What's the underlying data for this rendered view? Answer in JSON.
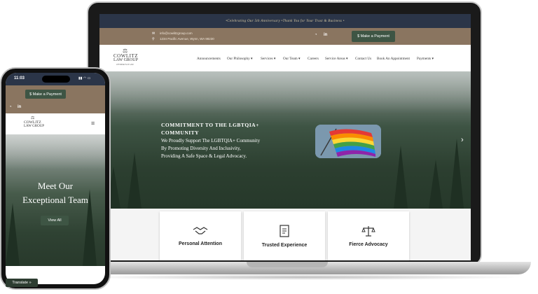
{
  "laptop_site": {
    "announcement": "•Celebrating Our 5th Anniversary •Thank You for Your Trust & Business •",
    "contact": {
      "email": "info@cowlitzgroup.com",
      "address": "1234 Pacific Avenue, Wynn, WA 98230"
    },
    "payment_button": "$ Make a Payment",
    "logo": {
      "line1": "COWLITZ",
      "line2": "LAW GROUP",
      "tagline": "ATTORNEYS AT LAW"
    },
    "nav": [
      {
        "label": "Announcements"
      },
      {
        "label": "Our Philosophy ▾"
      },
      {
        "label": "Services ▾"
      },
      {
        "label": "Our Team ▾"
      },
      {
        "label": "Careers"
      },
      {
        "label": "Service Areas ▾"
      },
      {
        "label": "Contact Us"
      },
      {
        "label": "Book An Appointment"
      },
      {
        "label": "Payments ▾"
      }
    ],
    "hero": {
      "heading_line1": "COMMITMENT TO THE LGBTQIA+",
      "heading_line2": "COMMUNITY",
      "body_line1": "We Proudly Support The LGBTQIA+ Community",
      "body_line2": "By Promoting Diversity And Inclusivity,",
      "body_line3": "Providing A Safe Space & Legal Advocacy."
    },
    "features": [
      {
        "label": "Personal Attention",
        "icon": "handshake-icon"
      },
      {
        "label": "Trusted Experience",
        "icon": "document-icon"
      },
      {
        "label": "Fierce Advocacy",
        "icon": "scales-icon"
      }
    ]
  },
  "phone_site": {
    "status_time": "11:03",
    "payment_button": "$ Make a Payment",
    "hero_line1": "Meet Our",
    "hero_line2": "Exceptional Team",
    "view_all": "View All",
    "translate": "Translate »"
  },
  "colors": {
    "announcement_bg": "#2b3548",
    "contact_bg": "#8a7560",
    "button_green": "#3e5544",
    "forest": "#2c3f30"
  }
}
